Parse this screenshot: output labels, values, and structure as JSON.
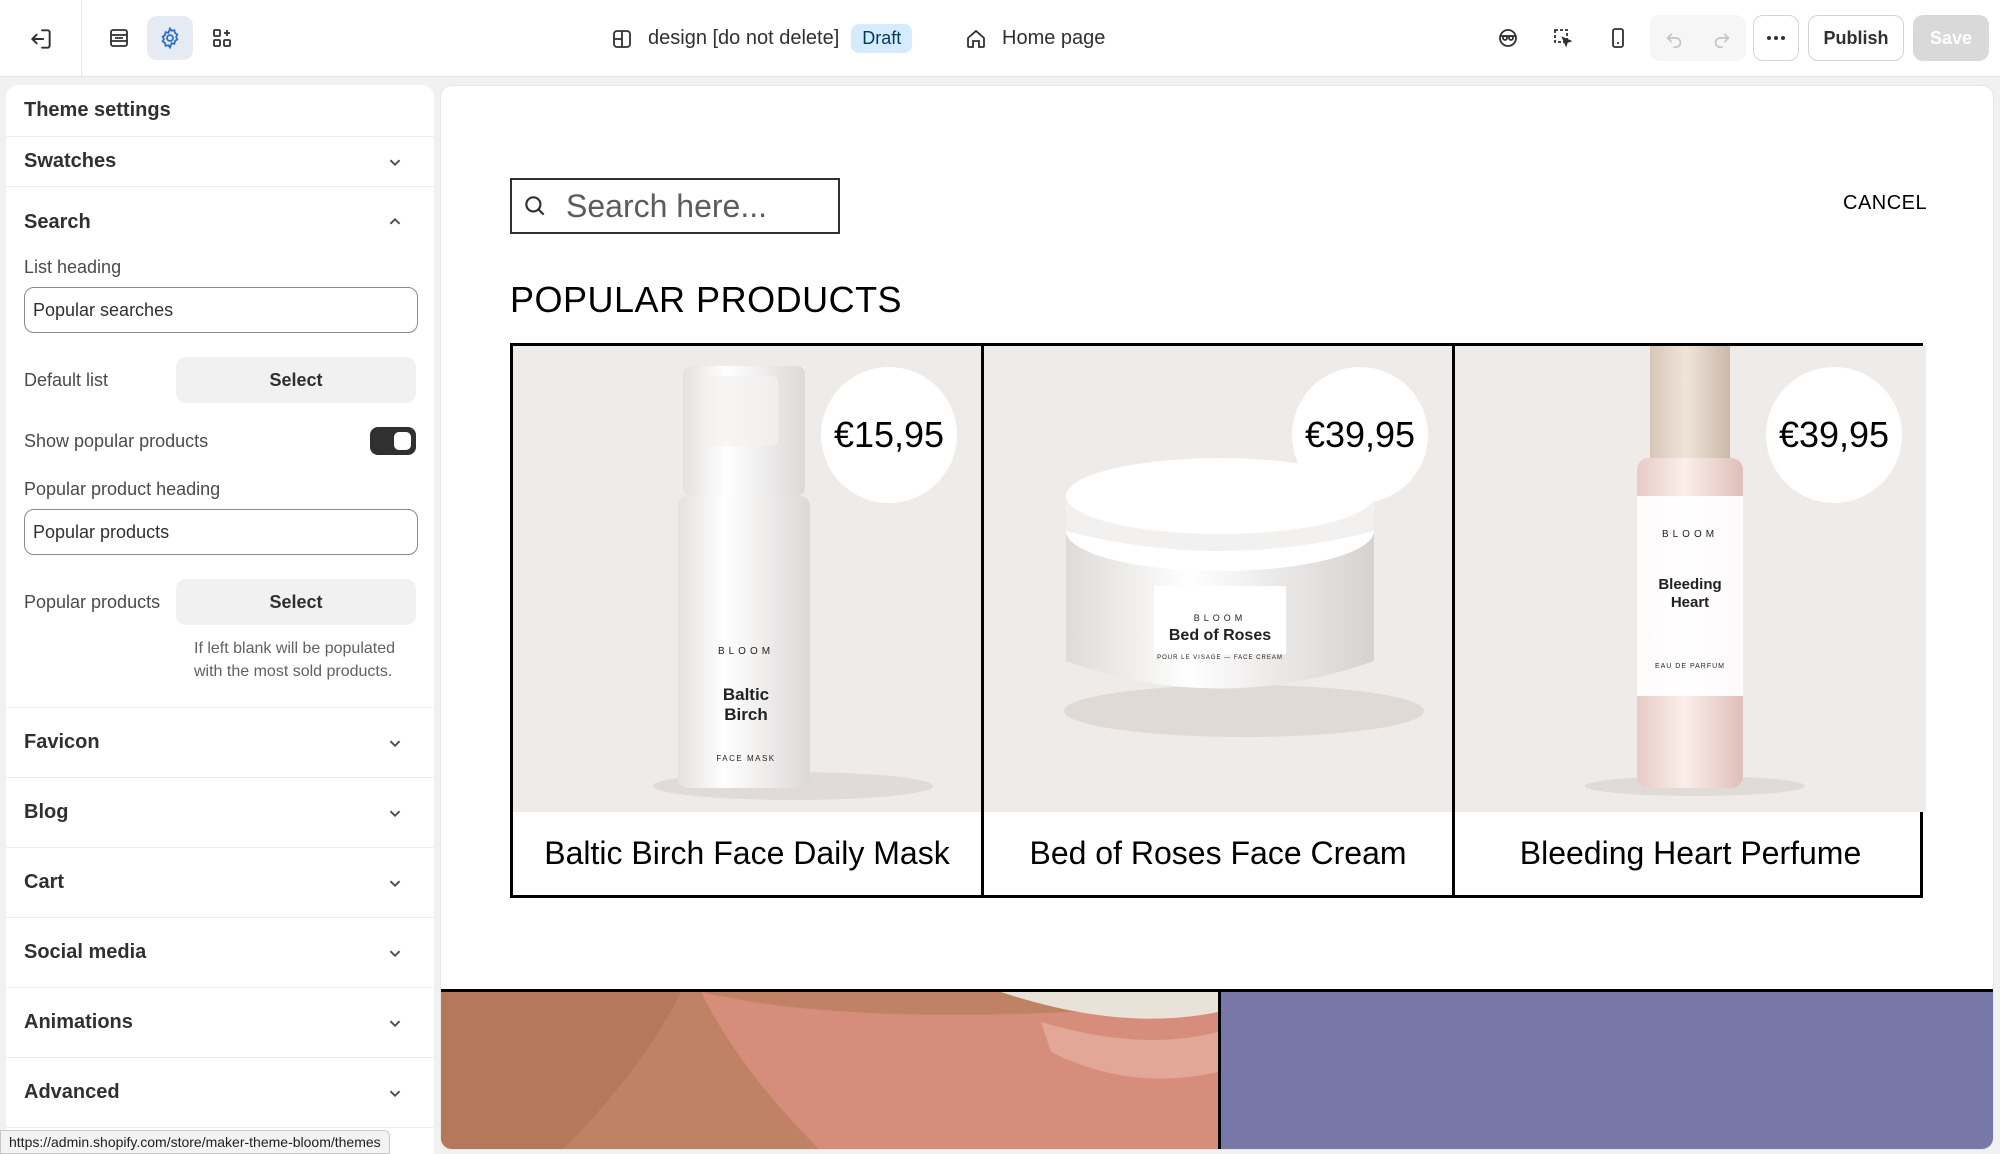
{
  "topbar": {
    "theme_name": "design [do not delete]",
    "status_badge": "Draft",
    "page_name": "Home page",
    "publish_label": "Publish",
    "save_label": "Save"
  },
  "sidebar": {
    "title": "Theme settings",
    "sections": {
      "swatches": "Swatches",
      "search": "Search",
      "favicon": "Favicon",
      "blog": "Blog",
      "cart": "Cart",
      "social": "Social media",
      "animations": "Animations",
      "advanced": "Advanced"
    },
    "search": {
      "list_heading_label": "List heading",
      "list_heading_value": "Popular searches",
      "default_list_label": "Default list",
      "select_label": "Select",
      "show_popular_label": "Show popular products",
      "show_popular_on": true,
      "popular_heading_label": "Popular product heading",
      "popular_heading_value": "Popular products",
      "popular_products_label": "Popular products",
      "help_text": "If left blank will be populated with the most sold products."
    }
  },
  "statusbar": {
    "url": "https://admin.shopify.com/store/maker-theme-bloom/themes"
  },
  "preview": {
    "search_placeholder": "Search here...",
    "cancel_label": "CANCEL",
    "heading": "POPULAR PRODUCTS",
    "products": [
      {
        "name": "Baltic Birch Face Daily Mask",
        "price": "€15,95",
        "brand": "BLOOM",
        "label": "Baltic Birch",
        "sub": "FACE MASK"
      },
      {
        "name": "Bed of Roses Face Cream",
        "price": "€39,95",
        "brand": "BLOOM",
        "label": "Bed of Roses",
        "sub": "POUR LE VISAGE — FACE CREAM"
      },
      {
        "name": "Bleeding Heart Perfume",
        "price": "€39,95",
        "brand": "BLOOM",
        "label": "Bleeding Heart",
        "sub": "EAU DE PARFUM"
      }
    ]
  },
  "colors": {
    "accent_active": "#e6eaf2",
    "draft_badge": "#d5ebff",
    "banner_right": "#7777a8"
  }
}
